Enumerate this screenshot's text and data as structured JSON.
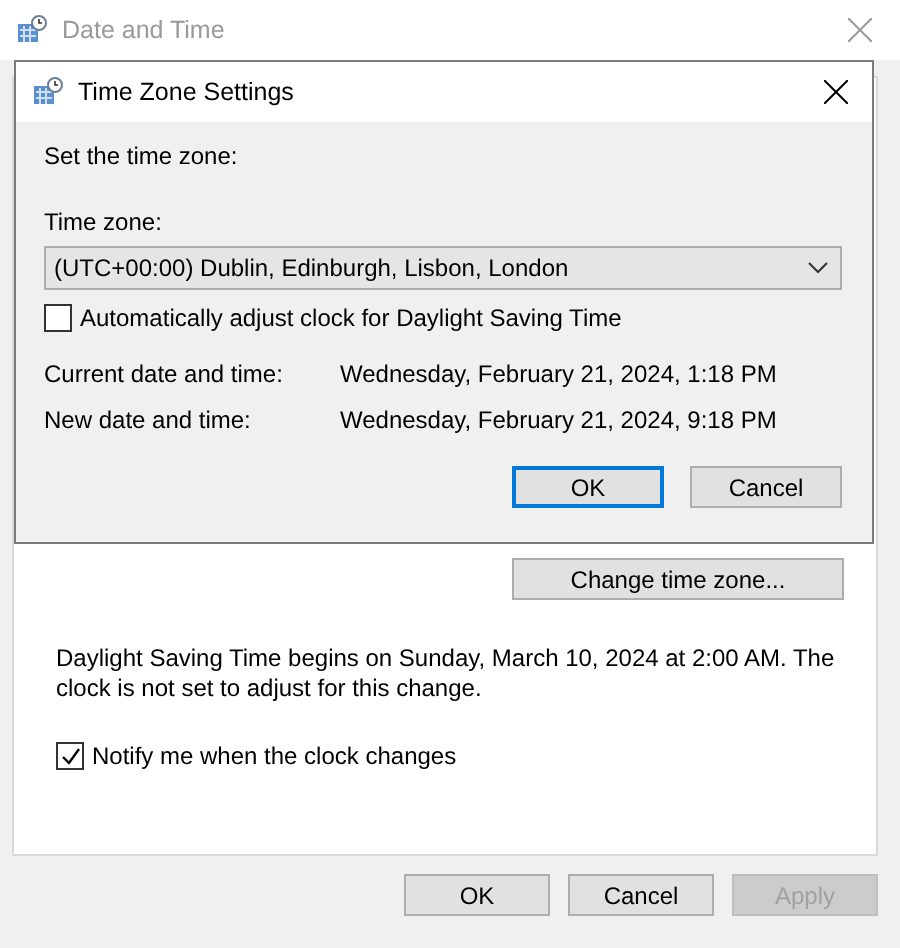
{
  "window": {
    "title": "Date and Time",
    "active": false
  },
  "change_time_zone_button": {
    "label": "Change time zone..."
  },
  "dst_notice": "Daylight Saving Time begins on Sunday, March 10, 2024 at 2:00 AM. The clock is not set to adjust for this change.",
  "notify_checkbox": {
    "label": "Notify me when the clock changes",
    "checked": true
  },
  "buttons": [
    {
      "label": "OK",
      "disabled": false
    },
    {
      "label": "Cancel",
      "disabled": false
    },
    {
      "label": "Apply",
      "disabled": true
    }
  ],
  "dialog": {
    "title": "Time Zone Settings",
    "active": true,
    "heading": "Set the time zone:",
    "time_zone_label": "Time zone:",
    "time_zone_value": "(UTC+00:00) Dublin, Edinburgh, Lisbon, London",
    "dst_checkbox": {
      "label": "Automatically adjust clock for Daylight Saving Time",
      "checked": false
    },
    "rows": [
      {
        "label": "Current date and time:",
        "value": "Wednesday, February 21, 2024, 1:18 PM"
      },
      {
        "label": "New date and time:",
        "value": "Wednesday, February 21, 2024, 9:18 PM"
      }
    ],
    "buttons": [
      {
        "label": "OK",
        "default": true
      },
      {
        "label": "Cancel",
        "default": false
      }
    ]
  }
}
